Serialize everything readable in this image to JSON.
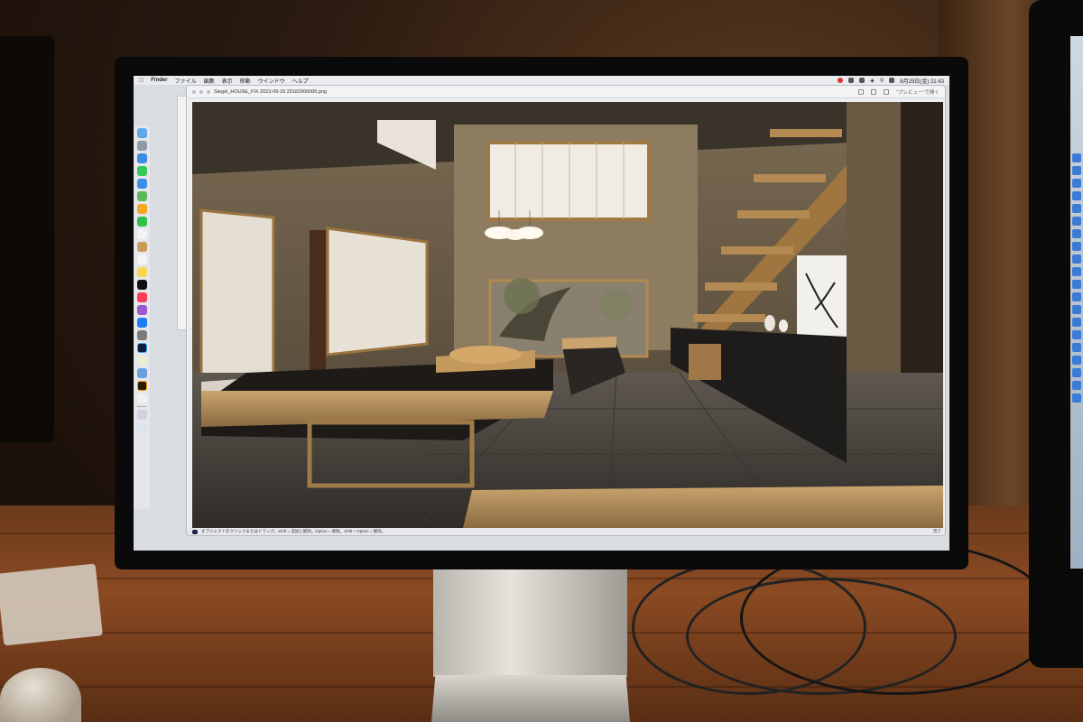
{
  "menubar": {
    "apple_icon": "apple-icon",
    "app_name": "Finder",
    "items": [
      "ファイル",
      "編集",
      "表示",
      "移動",
      "ウインドウ",
      "ヘルプ"
    ],
    "clock": "8月29日(金) 21:43"
  },
  "preview_window": {
    "title": "Siegel_HOUSE_FIX 2023-09-29 20182900000.png",
    "open_button": "\"プレビュー\"で開く",
    "status_text": "オブジェクトをクリックまたはドラッグ。Shift = 追加と解除。Option = 複製。Shift + Option = 解除。",
    "status_right": "完了"
  },
  "dock": {
    "apps": [
      "finder",
      "launchpad",
      "safari",
      "messages",
      "mail",
      "maps",
      "photos",
      "facetime",
      "calendar",
      "contacts",
      "reminders",
      "notes",
      "music",
      "podcasts",
      "tv",
      "app-store",
      "system-settings",
      "photoshop",
      "illustrator",
      "textedit",
      "preview",
      "trash"
    ]
  },
  "colors": {
    "screen_bg": "#d9dde2",
    "window_chrome": "#f2f3f5",
    "accent": "#3a7bd5"
  }
}
